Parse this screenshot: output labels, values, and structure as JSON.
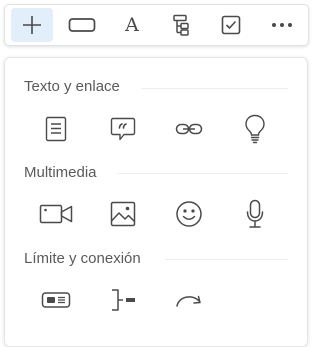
{
  "toolbar": {
    "tools": [
      {
        "name": "add-icon",
        "active": true
      },
      {
        "name": "shape-icon"
      },
      {
        "name": "text-icon",
        "glyph": "A"
      },
      {
        "name": "tree-icon"
      },
      {
        "name": "checkbox-icon"
      },
      {
        "name": "more-icon"
      }
    ]
  },
  "panel": {
    "sections": [
      {
        "title": "Texto y enlace",
        "items": [
          "note-icon",
          "comment-icon",
          "link-icon",
          "idea-icon"
        ]
      },
      {
        "title": "Multimedia",
        "items": [
          "video-icon",
          "image-icon",
          "emoji-icon",
          "microphone-icon"
        ]
      },
      {
        "title": "Límite y conexión",
        "items": [
          "boundary-icon",
          "connector-icon",
          "relationship-arrow-icon"
        ]
      }
    ]
  },
  "colors": {
    "icon": "#4a4a4a",
    "active_bg": "#e3eefb",
    "title": "#5a5a5a",
    "border": "#dfe3e8"
  }
}
